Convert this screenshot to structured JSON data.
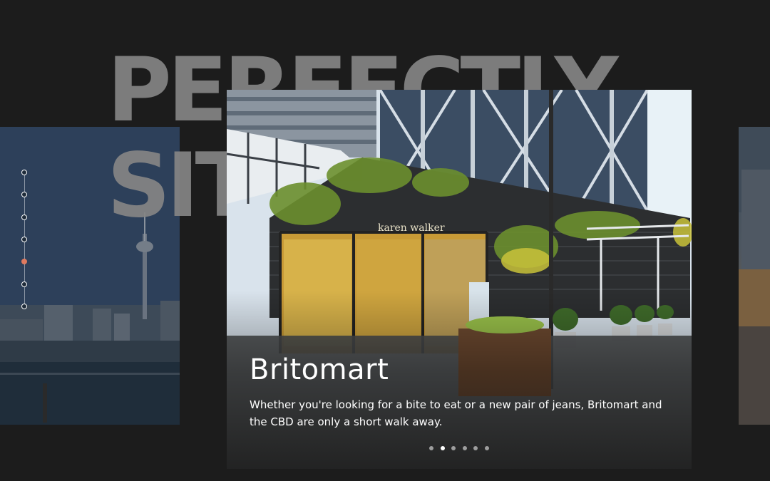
{
  "headline": {
    "line1": "PERFECTLY",
    "line2": "SITUATED"
  },
  "slide": {
    "title": "Britomart",
    "description": "Whether you're looking for a bite to eat or a new pair of jeans, Britomart and the CBD are only a short walk away.",
    "store_sign": "karen walker"
  },
  "dot_nav": {
    "count": 7,
    "active_index": 4,
    "accent": "#e07a5f"
  },
  "pager": {
    "count": 6,
    "active_index": 1
  },
  "colors": {
    "background": "#1c1c1c",
    "headline": "#858585"
  }
}
